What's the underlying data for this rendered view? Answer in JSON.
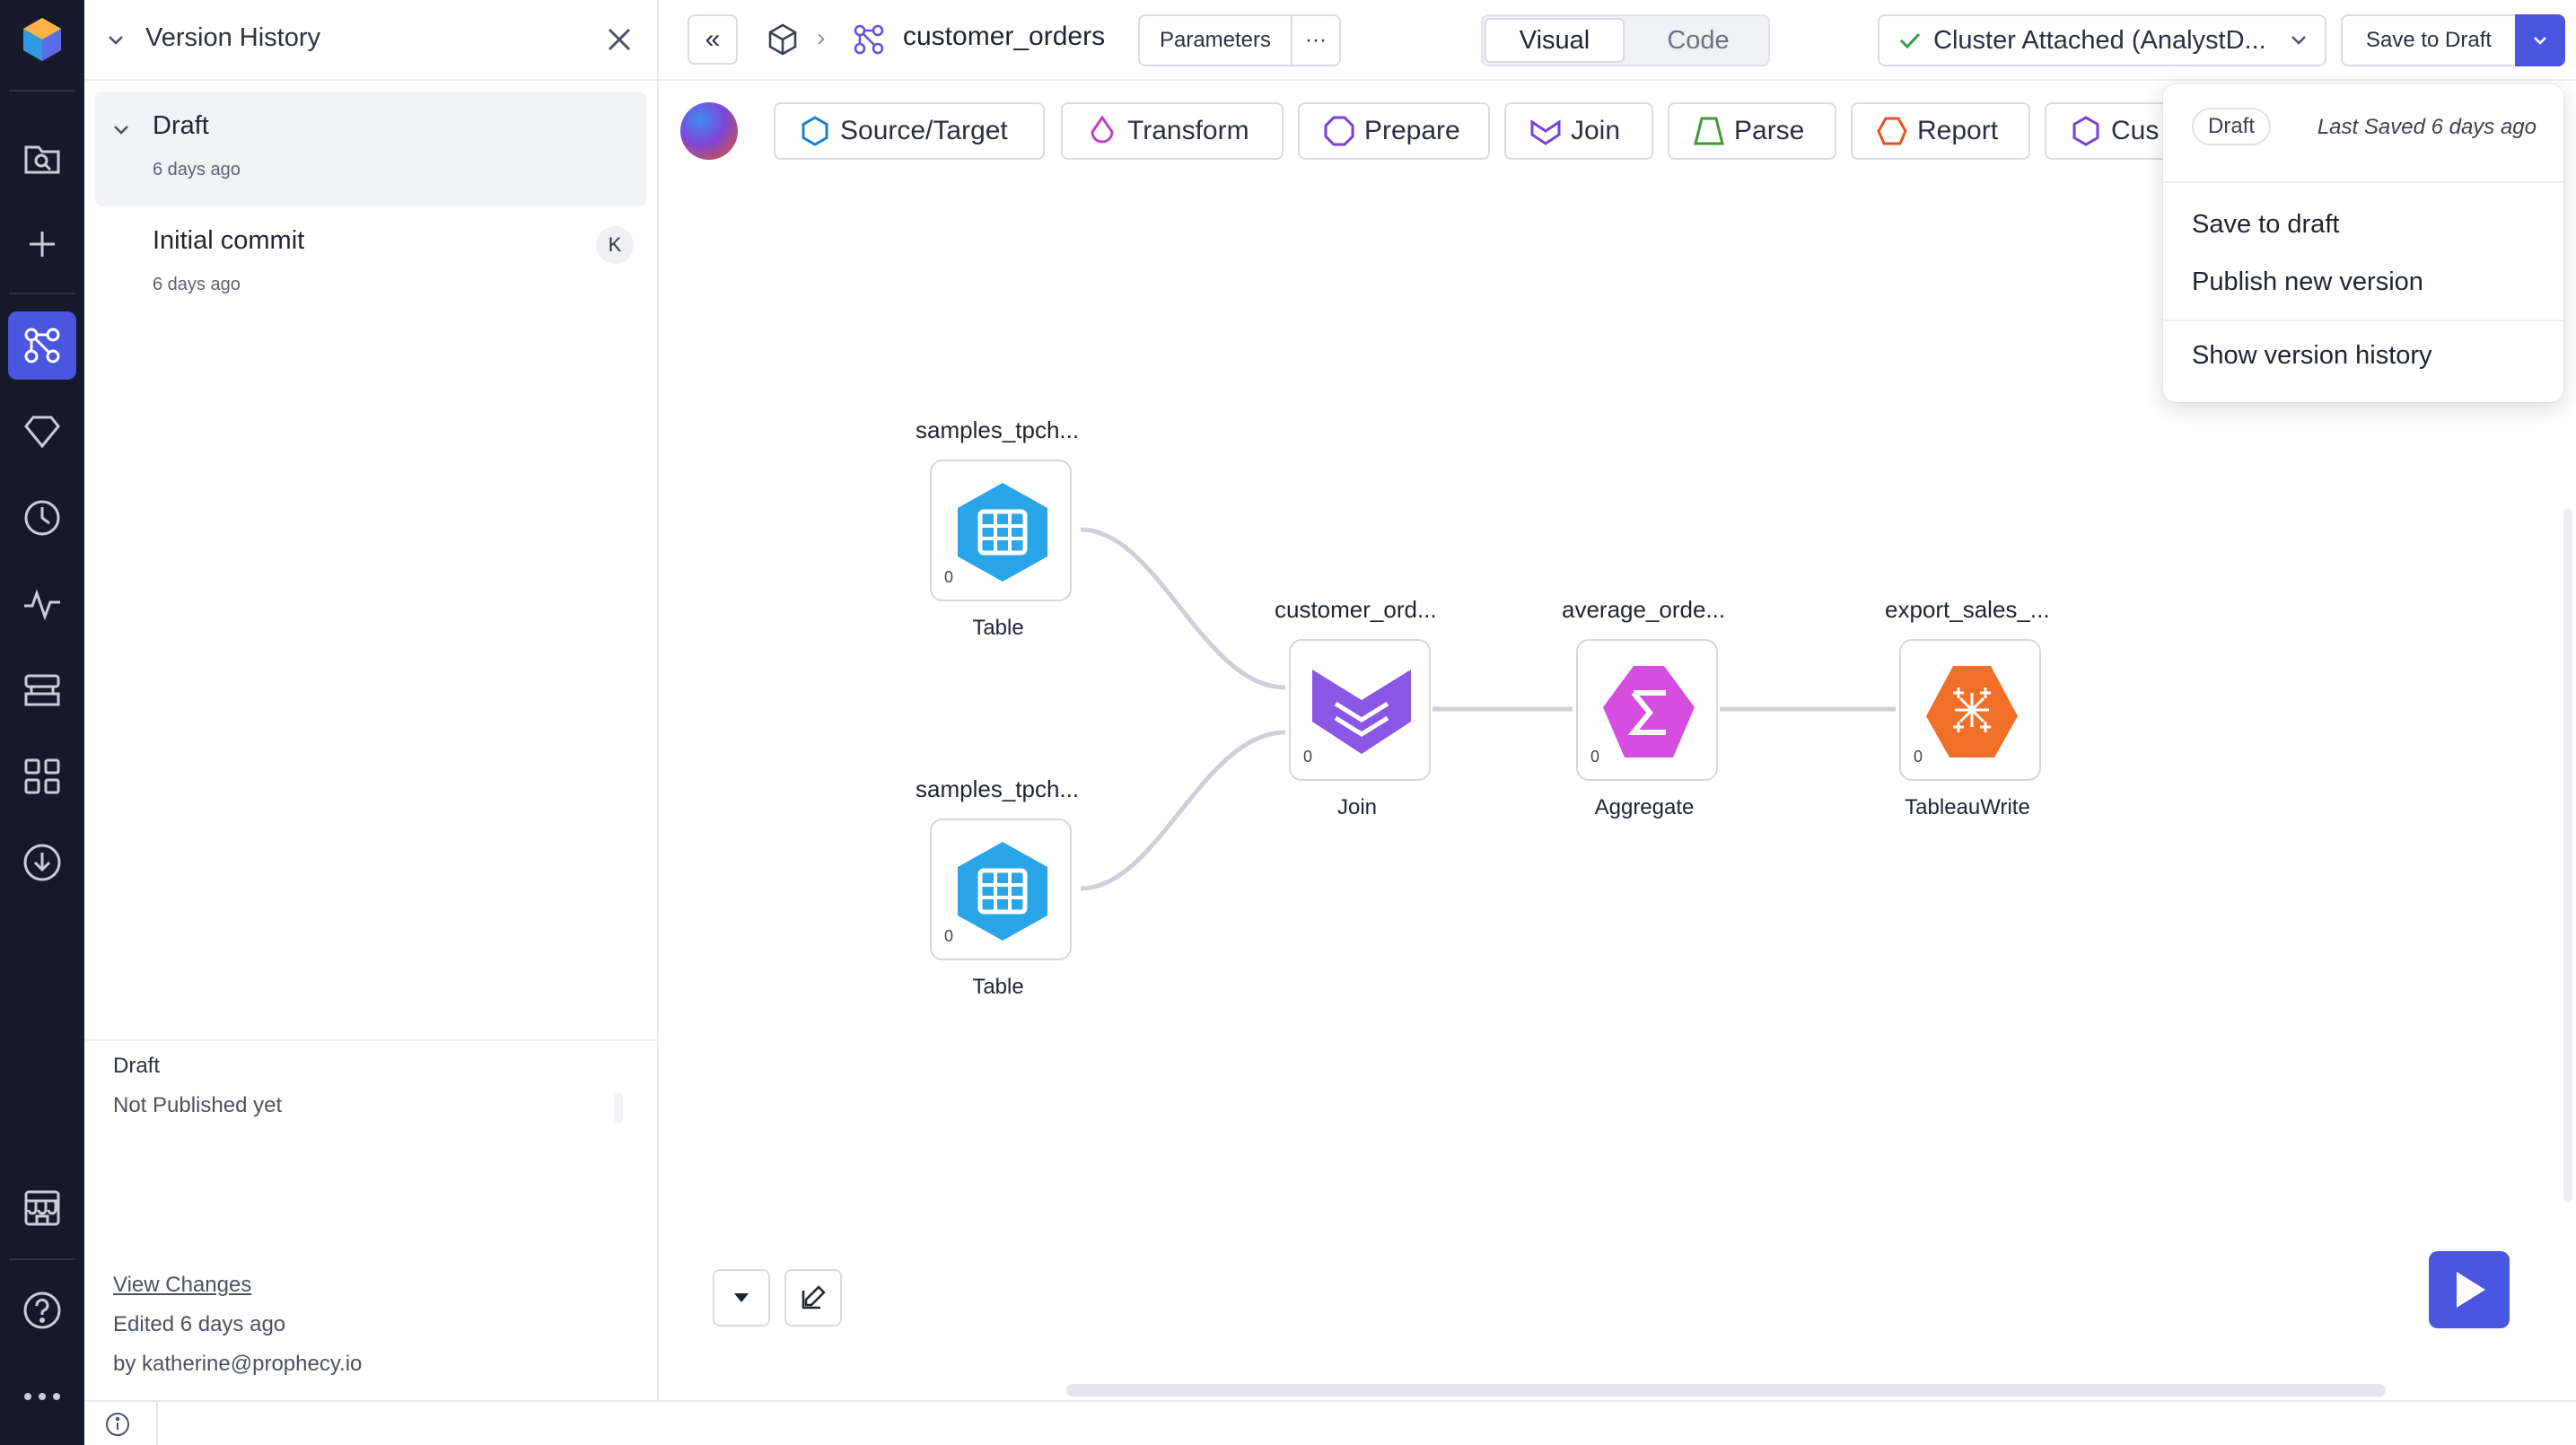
{
  "sidebar": {
    "items": [
      {
        "icon": "logo-icon"
      },
      {
        "icon": "folder-search-icon"
      },
      {
        "icon": "plus-icon"
      },
      {
        "icon": "pipeline-graph-icon",
        "active": true
      },
      {
        "icon": "gem-diamond-icon"
      },
      {
        "icon": "clock-icon"
      },
      {
        "icon": "activity-pulse-icon"
      },
      {
        "icon": "stack-layers-icon"
      },
      {
        "icon": "grid-apps-icon"
      },
      {
        "icon": "download-circle-icon"
      },
      {
        "icon": "marketplace-store-icon"
      },
      {
        "icon": "help-circle-icon"
      },
      {
        "icon": "more-dots-icon"
      }
    ],
    "active_color": "#4a55e0",
    "bg_color": "#151a2a"
  },
  "version_history": {
    "title": "Version History",
    "versions": [
      {
        "name": "Draft",
        "time": "6 days ago"
      },
      {
        "name": "Initial commit",
        "time": "6 days ago",
        "avatar": "K"
      }
    ],
    "footer": {
      "status_title": "Draft",
      "status_sub": "Not Published yet",
      "view_changes": "View Changes",
      "edited": "Edited 6 days ago",
      "author": "by katherine@prophecy.io"
    }
  },
  "topbar": {
    "collapse": "«",
    "breadcrumb_separator": "›",
    "pipeline_name": "customer_orders",
    "parameters_label": "Parameters",
    "more_label": "···",
    "tabs": [
      "Visual",
      "Code"
    ],
    "cluster_label": "Cluster Attached (AnalystD...",
    "save_label": "Save to Draft"
  },
  "gems": [
    {
      "label": "Source/Target",
      "color": "#1f7fcc"
    },
    {
      "label": "Transform",
      "color": "#c03fc9"
    },
    {
      "label": "Prepare",
      "color": "#7a3fd6"
    },
    {
      "label": "Join",
      "color": "#7a3fd6"
    },
    {
      "label": "Parse",
      "color": "#3f9a2e"
    },
    {
      "label": "Report",
      "color": "#e0541f"
    },
    {
      "label": "Cus",
      "color": "#7a3fd6"
    }
  ],
  "canvas": {
    "nodes": [
      {
        "title": "samples_tpch...",
        "type": "Table",
        "count": "0"
      },
      {
        "title": "samples_tpch...",
        "type": "Table",
        "count": "0"
      },
      {
        "title": "customer_ord...",
        "type": "Join",
        "count": "0"
      },
      {
        "title": "average_orde...",
        "type": "Aggregate",
        "count": "0"
      },
      {
        "title": "export_sales_...",
        "type": "TableauWrite",
        "count": "0"
      }
    ]
  },
  "dropdown": {
    "badge": "Draft",
    "last_saved": "Last Saved 6 days ago",
    "items": [
      "Save to draft",
      "Publish new version",
      "Show version history"
    ]
  }
}
